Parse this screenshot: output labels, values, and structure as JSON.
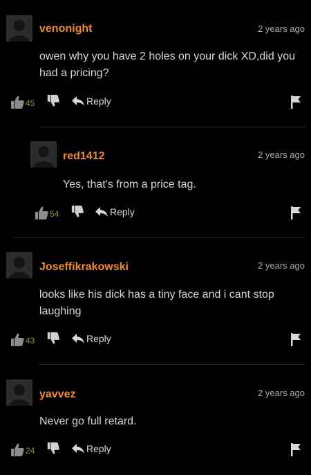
{
  "comments": [
    {
      "username": "venonight",
      "time": "2 years ago",
      "text": "owen why you have 2 holes on your dick XD,did you had a pricing?",
      "likes": "45",
      "reply_label": "Reply"
    },
    {
      "username": "red1412",
      "time": "2 years ago",
      "text": "Yes, that's from a price tag.",
      "likes": "54",
      "reply_label": "Reply"
    },
    {
      "username": "Joseffikrakowski",
      "time": "2 years ago",
      "text": "looks like his dick has a tiny face and i cant stop laughing",
      "likes": "43",
      "reply_label": "Reply"
    },
    {
      "username": "yavvez",
      "time": "2 years ago",
      "text": "Never go full retard.",
      "likes": "24",
      "reply_label": "Reply"
    }
  ],
  "colors": {
    "background": "#000000",
    "username": "#f08b27",
    "like_count": "#7d9a3d",
    "text": "#d6d6d6",
    "timestamp": "#a9a9a9"
  },
  "icons": [
    "avatar-placeholder-icon",
    "thumbs-up-icon",
    "thumbs-down-icon",
    "reply-arrow-icon",
    "flag-icon"
  ]
}
